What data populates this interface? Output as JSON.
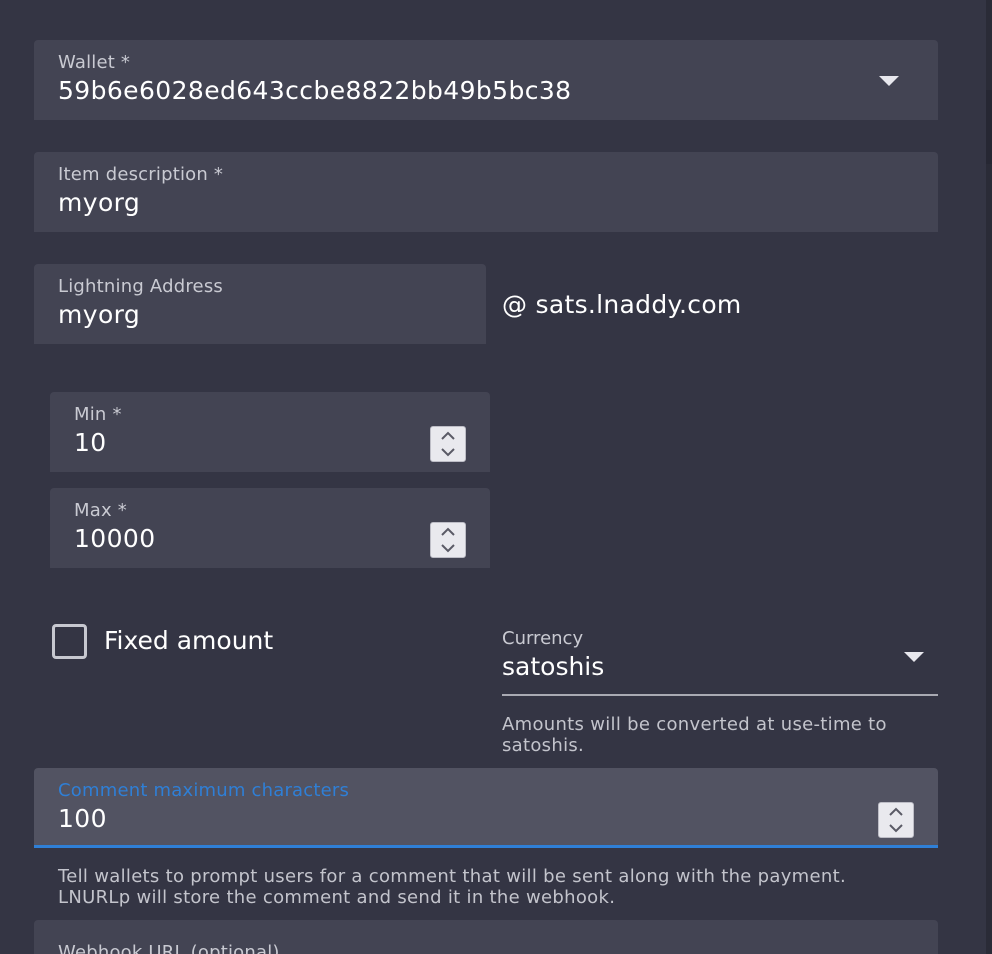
{
  "wallet": {
    "label": "Wallet *",
    "value": "59b6e6028ed643ccbe8822bb49b5bc38"
  },
  "item_description": {
    "label": "Item description *",
    "value": "myorg"
  },
  "lightning_address": {
    "label": "Lightning Address",
    "value": "myorg",
    "suffix": "@ sats.lnaddy.com"
  },
  "min": {
    "label": "Min *",
    "value": "10"
  },
  "max": {
    "label": "Max *",
    "value": "10000"
  },
  "fixed_amount": {
    "label": "Fixed amount",
    "checked": false
  },
  "currency": {
    "label": "Currency",
    "value": "satoshis",
    "hint": "Amounts will be converted at use-time to satoshis."
  },
  "comment": {
    "label": "Comment maximum characters",
    "value": "100",
    "hint": "Tell wallets to prompt users for a comment that will be sent along with the payment. LNURLp will store the comment and send it in the webhook."
  },
  "webhook": {
    "label": "Webhook URL (optional)"
  },
  "colors": {
    "background": "#343544",
    "field": "#434453",
    "focused_field": "#525362",
    "accent": "#2f7fd6"
  },
  "icons": {
    "dropdown": "caret-down-icon",
    "stepper": "stepper-arrows-icon",
    "checkbox": "checkbox-icon"
  }
}
